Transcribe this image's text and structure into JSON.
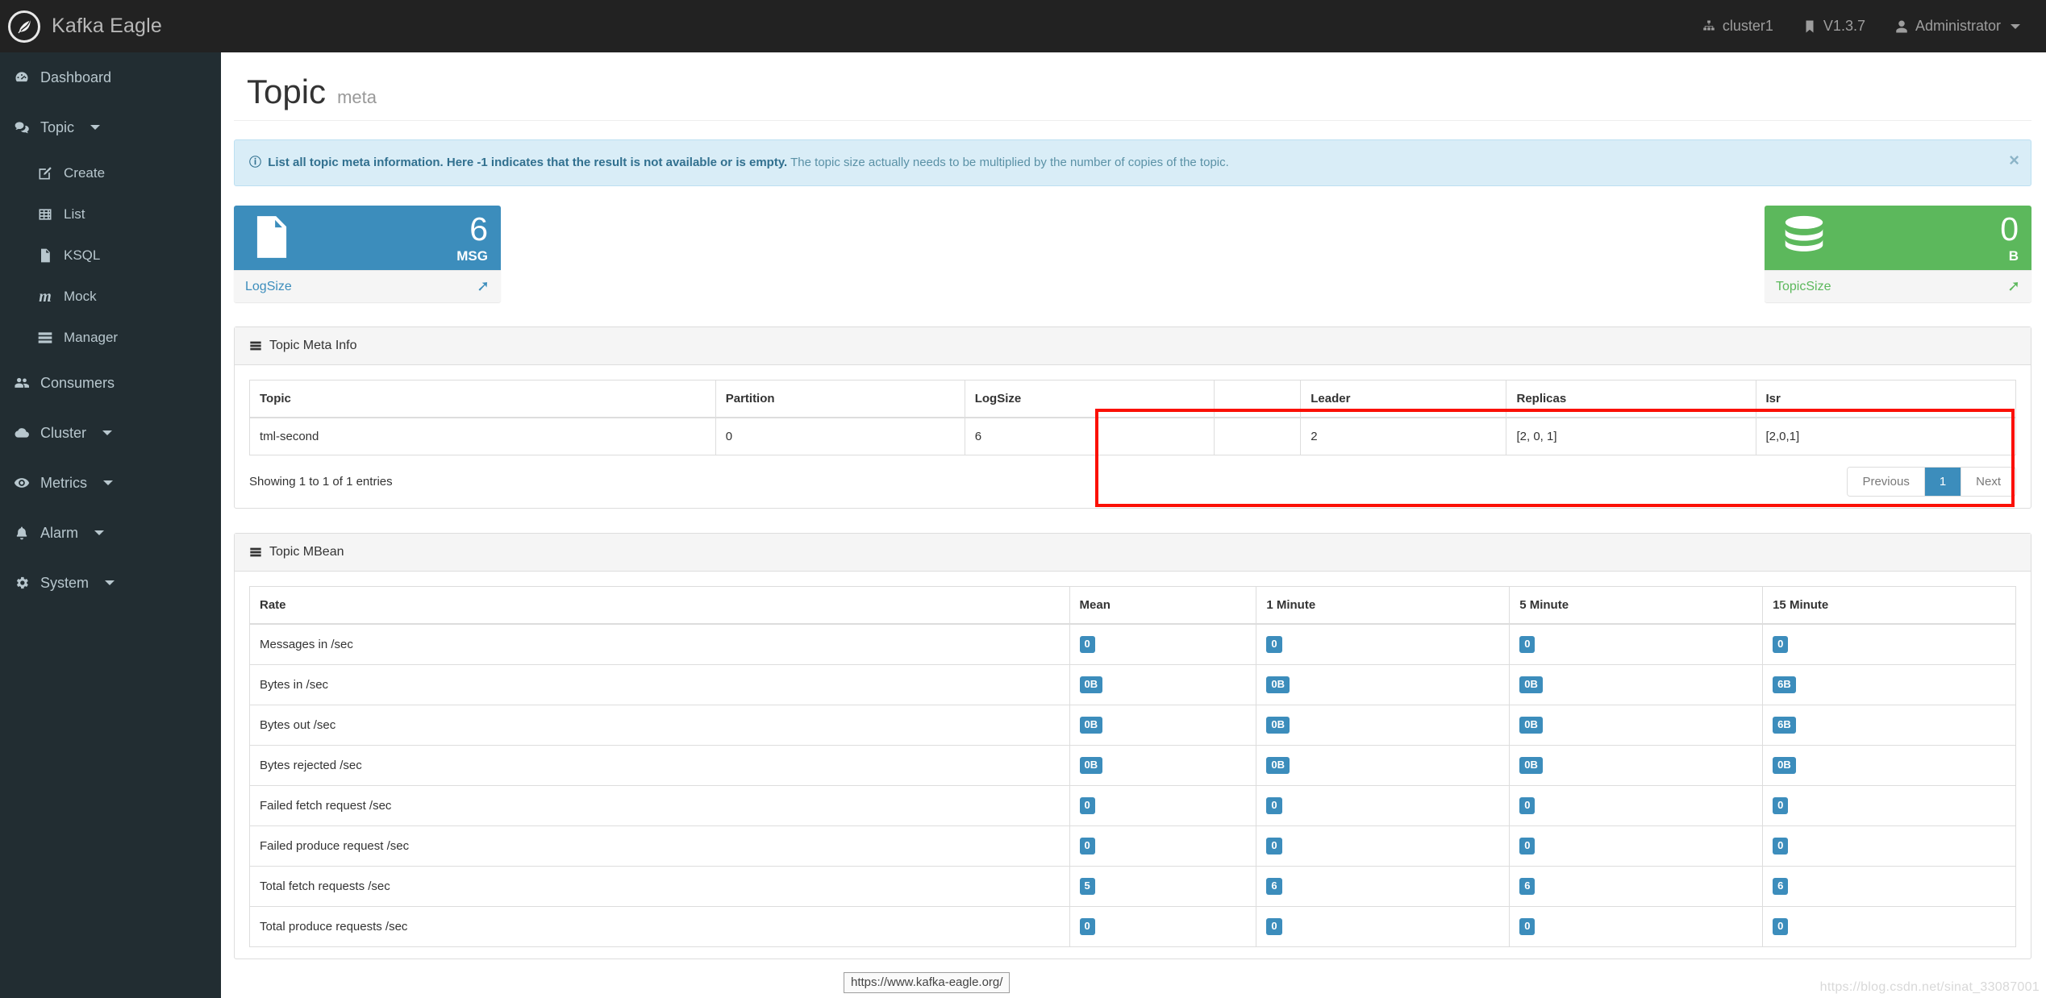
{
  "navbar": {
    "brand": "Kafka Eagle",
    "brand_logo_icon": "feather-logo-icon",
    "items": [
      {
        "label": "cluster1",
        "icon": "sitemap-icon"
      },
      {
        "label": "V1.3.7",
        "icon": "bookmark-icon"
      },
      {
        "label": "Administrator",
        "icon": "user-icon",
        "has_caret": true
      }
    ]
  },
  "sidebar": {
    "items": [
      {
        "label": "Dashboard",
        "icon": "dashboard-icon",
        "sub": false,
        "caret": false
      },
      {
        "label": "Topic",
        "icon": "comments-icon",
        "sub": false,
        "caret": true
      },
      {
        "label": "Create",
        "icon": "edit-icon",
        "sub": true,
        "caret": false
      },
      {
        "label": "List",
        "icon": "table-icon",
        "sub": true,
        "caret": false
      },
      {
        "label": "KSQL",
        "icon": "file-text-icon",
        "sub": true,
        "caret": false
      },
      {
        "label": "Mock",
        "icon": "mock-m-icon",
        "sub": true,
        "caret": false
      },
      {
        "label": "Manager",
        "icon": "server-icon",
        "sub": true,
        "caret": false
      },
      {
        "label": "Consumers",
        "icon": "users-icon",
        "sub": false,
        "caret": false
      },
      {
        "label": "Cluster",
        "icon": "cloud-icon",
        "sub": false,
        "caret": true
      },
      {
        "label": "Metrics",
        "icon": "eye-icon",
        "sub": false,
        "caret": true
      },
      {
        "label": "Alarm",
        "icon": "bell-icon",
        "sub": false,
        "caret": true
      },
      {
        "label": "System",
        "icon": "gear-icon",
        "sub": false,
        "caret": true
      }
    ]
  },
  "page": {
    "title": "Topic",
    "subtitle": "meta"
  },
  "alert": {
    "icon": "info-circle-icon",
    "strong_text": "List all topic meta information. Here -1 indicates that the result is not available or is empty.",
    "muted_text": "The topic size actually needs to be multiplied by the number of copies of the topic.",
    "close_label": "×"
  },
  "cards": [
    {
      "id": "logsize",
      "icon": "file-document-icon",
      "value": "6",
      "unit": "MSG",
      "footer_label": "LogSize",
      "arrow": "▶",
      "color": "#3c8dbc"
    },
    {
      "id": "topicsize",
      "icon": "database-icon",
      "value": "0",
      "unit": "B",
      "footer_label": "TopicSize",
      "arrow": "▶",
      "color": "#5cb85c"
    }
  ],
  "meta_panel": {
    "icon": "server-icon",
    "title": "Topic Meta Info",
    "columns": [
      "Topic",
      "Partition",
      "LogSize",
      "Leader",
      "Replicas",
      "Isr"
    ],
    "rows": [
      [
        "tml-second",
        "0",
        "6",
        "2",
        "[2, 0, 1]",
        "[2,0,1]"
      ]
    ],
    "info": "Showing 1 to 1 of 1 entries",
    "pager": {
      "previous": "Previous",
      "pages": [
        "1"
      ],
      "active_page": "1",
      "next": "Next"
    },
    "highlight_color": "#fb1005"
  },
  "mbean_panel": {
    "icon": "server-icon",
    "title": "Topic MBean",
    "columns": [
      "Rate",
      "Mean",
      "1 Minute",
      "5 Minute",
      "15 Minute"
    ],
    "rows": [
      {
        "rate": "Messages in /sec",
        "mean": "0",
        "m1": "0",
        "m5": "0",
        "m15": "0"
      },
      {
        "rate": "Bytes in /sec",
        "mean": "0B",
        "m1": "0B",
        "m5": "0B",
        "m15": "6B"
      },
      {
        "rate": "Bytes out /sec",
        "mean": "0B",
        "m1": "0B",
        "m5": "0B",
        "m15": "6B"
      },
      {
        "rate": "Bytes rejected /sec",
        "mean": "0B",
        "m1": "0B",
        "m5": "0B",
        "m15": "0B"
      },
      {
        "rate": "Failed fetch request /sec",
        "mean": "0",
        "m1": "0",
        "m5": "0",
        "m15": "0"
      },
      {
        "rate": "Failed produce request /sec",
        "mean": "0",
        "m1": "0",
        "m5": "0",
        "m15": "0"
      },
      {
        "rate": "Total fetch requests /sec",
        "mean": "5",
        "m1": "6",
        "m5": "6",
        "m15": "6"
      },
      {
        "rate": "Total produce requests /sec",
        "mean": "0",
        "m1": "0",
        "m5": "0",
        "m15": "0"
      }
    ],
    "badge_color": "#3c8dbc"
  },
  "status": {
    "link_preview": "https://www.kafka-eagle.org/",
    "watermark": "https://blog.csdn.net/sinat_33087001"
  }
}
